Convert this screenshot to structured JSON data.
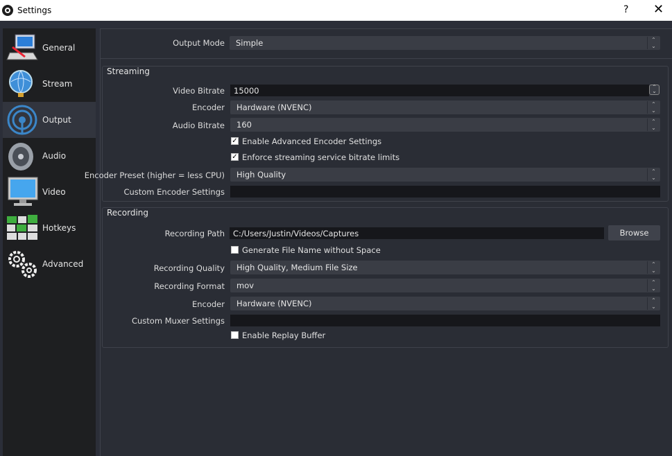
{
  "window": {
    "title": "Settings",
    "help_glyph": "?",
    "close_glyph": "✕"
  },
  "sidebar": {
    "items": [
      {
        "label": "General",
        "icon": "computer-icon"
      },
      {
        "label": "Stream",
        "icon": "globe-icon"
      },
      {
        "label": "Output",
        "icon": "broadcast-icon",
        "selected": true
      },
      {
        "label": "Audio",
        "icon": "speaker-icon"
      },
      {
        "label": "Video",
        "icon": "monitor-icon"
      },
      {
        "label": "Hotkeys",
        "icon": "keyboard-icon"
      },
      {
        "label": "Advanced",
        "icon": "gears-icon"
      }
    ]
  },
  "output_mode": {
    "label": "Output Mode",
    "value": "Simple"
  },
  "streaming": {
    "title": "Streaming",
    "video_bitrate": {
      "label": "Video Bitrate",
      "value": "15000"
    },
    "encoder": {
      "label": "Encoder",
      "value": "Hardware (NVENC)"
    },
    "audio_bitrate": {
      "label": "Audio Bitrate",
      "value": "160"
    },
    "advanced_encoder": {
      "label": "Enable Advanced Encoder Settings",
      "checked": true
    },
    "enforce_limits": {
      "label": "Enforce streaming service bitrate limits",
      "checked": true
    },
    "encoder_preset": {
      "label": "Encoder Preset (higher = less CPU)",
      "value": "High Quality"
    },
    "custom_encoder": {
      "label": "Custom Encoder Settings",
      "value": ""
    }
  },
  "recording": {
    "title": "Recording",
    "path": {
      "label": "Recording Path",
      "value": "C:/Users/Justin/Videos/Captures",
      "browse": "Browse"
    },
    "no_space": {
      "label": "Generate File Name without Space",
      "checked": false
    },
    "quality": {
      "label": "Recording Quality",
      "value": "High Quality, Medium File Size"
    },
    "format": {
      "label": "Recording Format",
      "value": "mov"
    },
    "encoder": {
      "label": "Encoder",
      "value": "Hardware (NVENC)"
    },
    "custom_muxer": {
      "label": "Custom Muxer Settings",
      "value": ""
    },
    "replay_buffer": {
      "label": "Enable Replay Buffer",
      "checked": false
    }
  }
}
